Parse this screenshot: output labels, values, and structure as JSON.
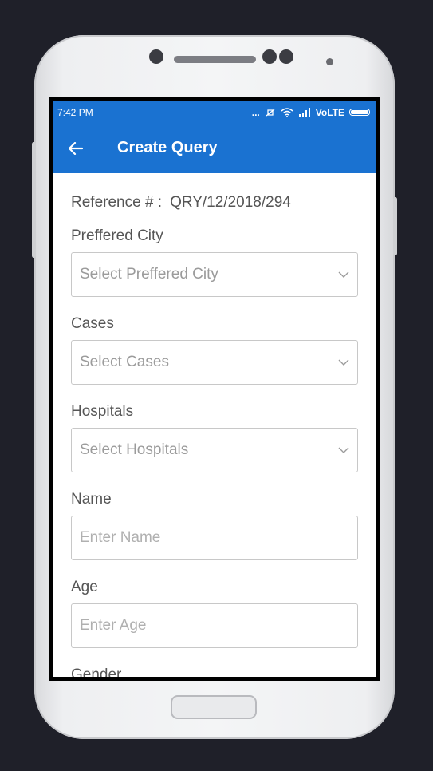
{
  "status_bar": {
    "time": "7:42 PM",
    "dots": "...",
    "network": "VoLTE"
  },
  "app_bar": {
    "title": "Create Query"
  },
  "form": {
    "reference_label": "Reference # :",
    "reference_value": "QRY/12/2018/294",
    "city": {
      "label": "Preffered City",
      "placeholder": "Select Preffered City"
    },
    "cases": {
      "label": "Cases",
      "placeholder": "Select Cases"
    },
    "hospitals": {
      "label": "Hospitals",
      "placeholder": "Select Hospitals"
    },
    "name": {
      "label": "Name",
      "placeholder": "Enter Name"
    },
    "age": {
      "label": "Age",
      "placeholder": "Enter Age"
    },
    "gender": {
      "label": "Gender"
    }
  },
  "colors": {
    "primary": "#1a72d1",
    "background": "#1f2029"
  },
  "icons": [
    "back-arrow-icon",
    "chevron-down-icon",
    "wifi-icon",
    "signal-icon",
    "battery-icon"
  ]
}
